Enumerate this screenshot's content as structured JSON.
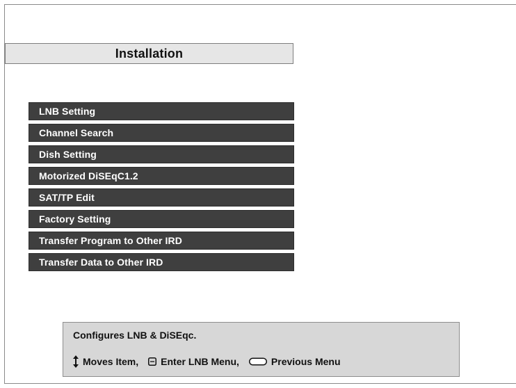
{
  "title": "Installation",
  "menu": {
    "items": [
      {
        "label": "LNB Setting"
      },
      {
        "label": "Channel Search"
      },
      {
        "label": "Dish Setting"
      },
      {
        "label": "Motorized DiSEqC1.2"
      },
      {
        "label": "SAT/TP Edit"
      },
      {
        "label": "Factory Setting"
      },
      {
        "label": "Transfer Program to Other IRD"
      },
      {
        "label": "Transfer Data to Other IRD"
      }
    ]
  },
  "help": {
    "description": "Configures LNB & DiSEqc.",
    "move_label": "Moves Item,",
    "enter_label": "Enter LNB Menu,",
    "previous_label": "Previous Menu",
    "icons": {
      "move": "up-down-arrow-icon",
      "enter": "ok-button-icon",
      "previous": "exit-button-icon"
    }
  },
  "colors": {
    "menu_item_bg": "#3f3f3f",
    "title_bg": "#e6e6e6",
    "help_bg": "#d7d7d7"
  }
}
